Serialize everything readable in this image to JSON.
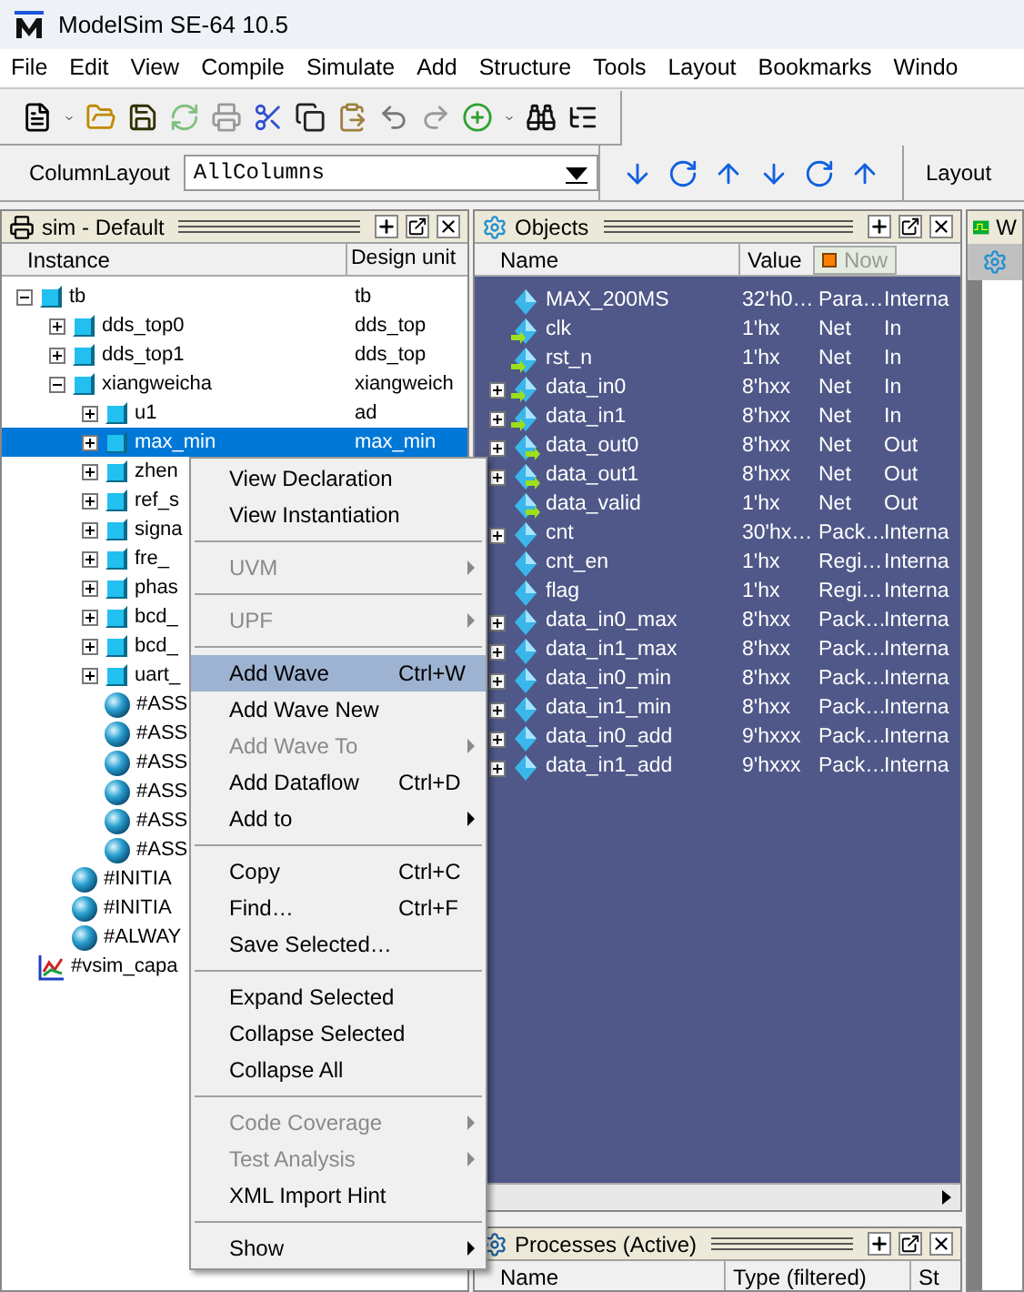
{
  "window": {
    "title": "ModelSim SE-64 10.5"
  },
  "menu_bar": [
    "File",
    "Edit",
    "View",
    "Compile",
    "Simulate",
    "Add",
    "Structure",
    "Tools",
    "Layout",
    "Bookmarks",
    "Windo"
  ],
  "column_layout": {
    "label": "ColumnLayout",
    "value": "AllColumns"
  },
  "layout_label": "Layout",
  "sim_panel": {
    "title": "sim - Default",
    "columns": [
      "Instance",
      "Design unit"
    ],
    "tree": [
      {
        "label": "tb",
        "unit": "tb",
        "kind": "instance",
        "expanded": true,
        "selected": false,
        "children": [
          {
            "label": "dds_top0",
            "unit": "dds_top",
            "kind": "instance",
            "expanded": false,
            "selected": false
          },
          {
            "label": "dds_top1",
            "unit": "dds_top",
            "kind": "instance",
            "expanded": false,
            "selected": false
          },
          {
            "label": "xiangweicha",
            "unit": "xiangweich",
            "kind": "instance",
            "expanded": true,
            "selected": false,
            "children": [
              {
                "label": "u1",
                "unit": "ad",
                "kind": "instance",
                "expanded": false,
                "selected": false
              },
              {
                "label": "max_min",
                "unit": "max_min",
                "kind": "instance",
                "expanded": false,
                "selected": true
              },
              {
                "label": "zhen",
                "kind": "instance",
                "expanded": false,
                "selected": false
              },
              {
                "label": "ref_s",
                "kind": "instance",
                "expanded": false,
                "selected": false
              },
              {
                "label": "signa",
                "kind": "instance",
                "expanded": false,
                "selected": false
              },
              {
                "label": "fre_",
                "kind": "instance",
                "expanded": false,
                "selected": false
              },
              {
                "label": "phas",
                "kind": "instance",
                "expanded": false,
                "selected": false
              },
              {
                "label": "bcd_",
                "kind": "instance",
                "expanded": false,
                "selected": false
              },
              {
                "label": "bcd_",
                "kind": "instance",
                "expanded": false,
                "selected": false
              },
              {
                "label": "uart_",
                "kind": "instance",
                "expanded": false,
                "selected": false
              },
              {
                "label": "#ASS",
                "kind": "process",
                "selected": false
              },
              {
                "label": "#ASS",
                "kind": "process",
                "selected": false
              },
              {
                "label": "#ASS",
                "kind": "process",
                "selected": false
              },
              {
                "label": "#ASS",
                "kind": "process",
                "selected": false
              },
              {
                "label": "#ASS",
                "kind": "process",
                "selected": false
              },
              {
                "label": "#ASS",
                "kind": "process",
                "selected": false
              }
            ]
          },
          {
            "label": "#INITIA",
            "kind": "process",
            "selected": false
          },
          {
            "label": "#INITIA",
            "kind": "process",
            "selected": false
          },
          {
            "label": "#ALWAY",
            "kind": "process",
            "selected": false
          }
        ]
      },
      {
        "label": "#vsim_capa",
        "kind": "capacity",
        "selected": false
      }
    ]
  },
  "objects_panel": {
    "title": "Objects",
    "columns": [
      "Name",
      "Value"
    ],
    "now_label": "Now",
    "rows": [
      {
        "name": "MAX_200MS",
        "value": "32'h0…",
        "column_3": "Para…",
        "column_4": "Interna",
        "kind": "internal",
        "expandable": false
      },
      {
        "name": "clk",
        "value": "1'hx",
        "column_3": "Net",
        "column_4": "In",
        "kind": "in",
        "expandable": false
      },
      {
        "name": "rst_n",
        "value": "1'hx",
        "column_3": "Net",
        "column_4": "In",
        "kind": "in",
        "expandable": false
      },
      {
        "name": "data_in0",
        "value": "8'hxx",
        "column_3": "Net",
        "column_4": "In",
        "kind": "in",
        "expandable": true
      },
      {
        "name": "data_in1",
        "value": "8'hxx",
        "column_3": "Net",
        "column_4": "In",
        "kind": "in",
        "expandable": true
      },
      {
        "name": "data_out0",
        "value": "8'hxx",
        "column_3": "Net",
        "column_4": "Out",
        "kind": "out",
        "expandable": true
      },
      {
        "name": "data_out1",
        "value": "8'hxx",
        "column_3": "Net",
        "column_4": "Out",
        "kind": "out",
        "expandable": true
      },
      {
        "name": "data_valid",
        "value": "1'hx",
        "column_3": "Net",
        "column_4": "Out",
        "kind": "out",
        "expandable": false
      },
      {
        "name": "cnt",
        "value": "30'hx…",
        "column_3": "Pack…",
        "column_4": "Interna",
        "kind": "internal",
        "expandable": true
      },
      {
        "name": "cnt_en",
        "value": "1'hx",
        "column_3": "Regi…",
        "column_4": "Interna",
        "kind": "internal",
        "expandable": false
      },
      {
        "name": "flag",
        "value": "1'hx",
        "column_3": "Regi…",
        "column_4": "Interna",
        "kind": "internal",
        "expandable": false
      },
      {
        "name": "data_in0_max",
        "value": "8'hxx",
        "column_3": "Pack…",
        "column_4": "Interna",
        "kind": "internal",
        "expandable": true
      },
      {
        "name": "data_in1_max",
        "value": "8'hxx",
        "column_3": "Pack…",
        "column_4": "Interna",
        "kind": "internal",
        "expandable": true
      },
      {
        "name": "data_in0_min",
        "value": "8'hxx",
        "column_3": "Pack…",
        "column_4": "Interna",
        "kind": "internal",
        "expandable": true
      },
      {
        "name": "data_in1_min",
        "value": "8'hxx",
        "column_3": "Pack…",
        "column_4": "Interna",
        "kind": "internal",
        "expandable": true
      },
      {
        "name": "data_in0_add",
        "value": "9'hxxx",
        "column_3": "Pack…",
        "column_4": "Interna",
        "kind": "internal",
        "expandable": true
      },
      {
        "name": "data_in1_add",
        "value": "9'hxxx",
        "column_3": "Pack…",
        "column_4": "Interna",
        "kind": "internal",
        "expandable": true
      }
    ]
  },
  "processes_panel": {
    "title": "Processes (Active)",
    "columns": [
      "Name",
      "Type (filtered)",
      "St"
    ]
  },
  "wave_panel": {
    "title": "W"
  },
  "context_menu": [
    {
      "kind": "item",
      "label": "View Declaration",
      "disabled": false,
      "submenu": false,
      "selected": false
    },
    {
      "kind": "item",
      "label": "View Instantiation",
      "disabled": false,
      "submenu": false,
      "selected": false
    },
    {
      "kind": "separator"
    },
    {
      "kind": "item",
      "label": "UVM",
      "disabled": true,
      "submenu": true,
      "selected": false
    },
    {
      "kind": "separator"
    },
    {
      "kind": "item",
      "label": "UPF",
      "disabled": true,
      "submenu": true,
      "selected": false
    },
    {
      "kind": "separator"
    },
    {
      "kind": "item",
      "label": "Add Wave",
      "shortcut": "Ctrl+W",
      "disabled": false,
      "submenu": false,
      "selected": true
    },
    {
      "kind": "item",
      "label": "Add Wave New",
      "disabled": false,
      "submenu": false,
      "selected": false
    },
    {
      "kind": "item",
      "label": "Add Wave To",
      "disabled": true,
      "submenu": true,
      "selected": false
    },
    {
      "kind": "item",
      "label": "Add Dataflow",
      "shortcut": "Ctrl+D",
      "disabled": false,
      "submenu": false,
      "selected": false
    },
    {
      "kind": "item",
      "label": "Add to",
      "disabled": false,
      "submenu": true,
      "selected": false
    },
    {
      "kind": "separator"
    },
    {
      "kind": "item",
      "label": "Copy",
      "shortcut": "Ctrl+C",
      "disabled": false,
      "submenu": false,
      "selected": false
    },
    {
      "kind": "item",
      "label": "Find…",
      "shortcut": "Ctrl+F",
      "disabled": false,
      "submenu": false,
      "selected": false
    },
    {
      "kind": "item",
      "label": "Save Selected…",
      "disabled": false,
      "submenu": false,
      "selected": false
    },
    {
      "kind": "separator"
    },
    {
      "kind": "item",
      "label": "Expand Selected",
      "disabled": false,
      "submenu": false,
      "selected": false
    },
    {
      "kind": "item",
      "label": "Collapse Selected",
      "disabled": false,
      "submenu": false,
      "selected": false
    },
    {
      "kind": "item",
      "label": "Collapse All",
      "disabled": false,
      "submenu": false,
      "selected": false
    },
    {
      "kind": "separator"
    },
    {
      "kind": "item",
      "label": "Code Coverage",
      "disabled": true,
      "submenu": true,
      "selected": false
    },
    {
      "kind": "item",
      "label": "Test Analysis",
      "disabled": true,
      "submenu": true,
      "selected": false
    },
    {
      "kind": "item",
      "label": "XML Import Hint",
      "disabled": false,
      "submenu": false,
      "selected": false
    },
    {
      "kind": "separator"
    },
    {
      "kind": "item",
      "label": "Show",
      "disabled": false,
      "submenu": true,
      "selected": false
    }
  ]
}
